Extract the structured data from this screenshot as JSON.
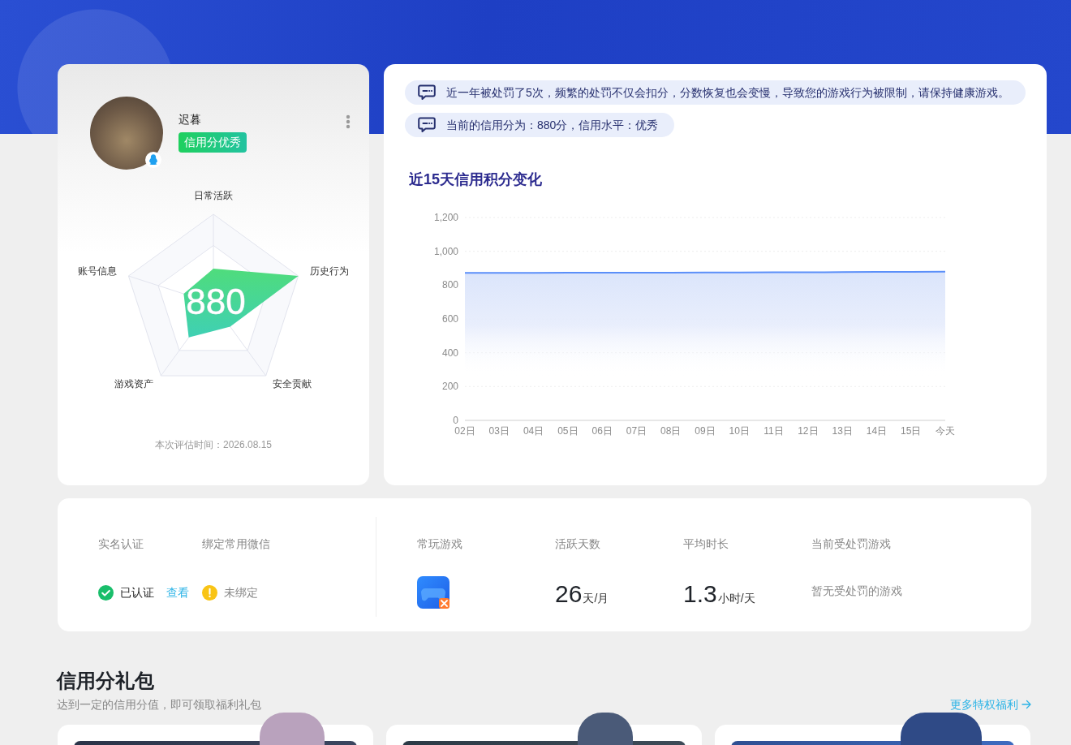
{
  "profile": {
    "name": "迟暮",
    "badge": "信用分优秀",
    "score": "880",
    "radar_labels": [
      "日常活跃",
      "历史行为",
      "安全贡献",
      "游戏资产",
      "账号信息"
    ],
    "evaluated_at": "本次评估时间：2026.08.15"
  },
  "notices": [
    "近一年被处罚了5次，频繁的处罚不仅会扣分，分数恢复也会变慢，导致您的游戏行为被限制，请保持健康游戏。",
    "当前的信用分为：880分，信用水平：优秀"
  ],
  "trend": {
    "chart_data": {
      "type": "area",
      "title": "近15天信用积分变化",
      "categories": [
        "02日",
        "03日",
        "04日",
        "05日",
        "06日",
        "07日",
        "08日",
        "09日",
        "10日",
        "11日",
        "12日",
        "13日",
        "14日",
        "15日",
        "今天"
      ],
      "series": [
        {
          "color": "#5b8ff9",
          "values": [
            872,
            872,
            872,
            873,
            873,
            874,
            874,
            875,
            875,
            876,
            876,
            877,
            878,
            879,
            880
          ]
        }
      ],
      "ylim": [
        0,
        1200
      ],
      "yticks": [
        0,
        200,
        400,
        600,
        800,
        {
          "value": 1000,
          "label": "1,000"
        },
        {
          "value": 1200,
          "label": "1,200"
        }
      ],
      "grid": true
    }
  },
  "account": {
    "items": [
      {
        "label": "实名认证",
        "value": "已认证",
        "confirmed": true,
        "link": "查看"
      },
      {
        "label": "绑定常用微信",
        "value": "未绑定",
        "confirmed": false
      }
    ]
  },
  "stats": [
    {
      "kind": "game",
      "label": "常玩游戏"
    },
    {
      "kind": "number",
      "label": "活跃天数",
      "value": "26",
      "unit": "天/月"
    },
    {
      "kind": "number",
      "label": "平均时长",
      "value": "1.3",
      "unit": "小时/天"
    },
    {
      "kind": "text",
      "label": "当前受处罚游戏",
      "value": "暂无受处罚的游戏"
    }
  ],
  "gift_section": {
    "title": "信用分礼包",
    "subtitle": "达到一定的信用分值，即可领取福利礼包",
    "more_link": "更多特权福利"
  }
}
